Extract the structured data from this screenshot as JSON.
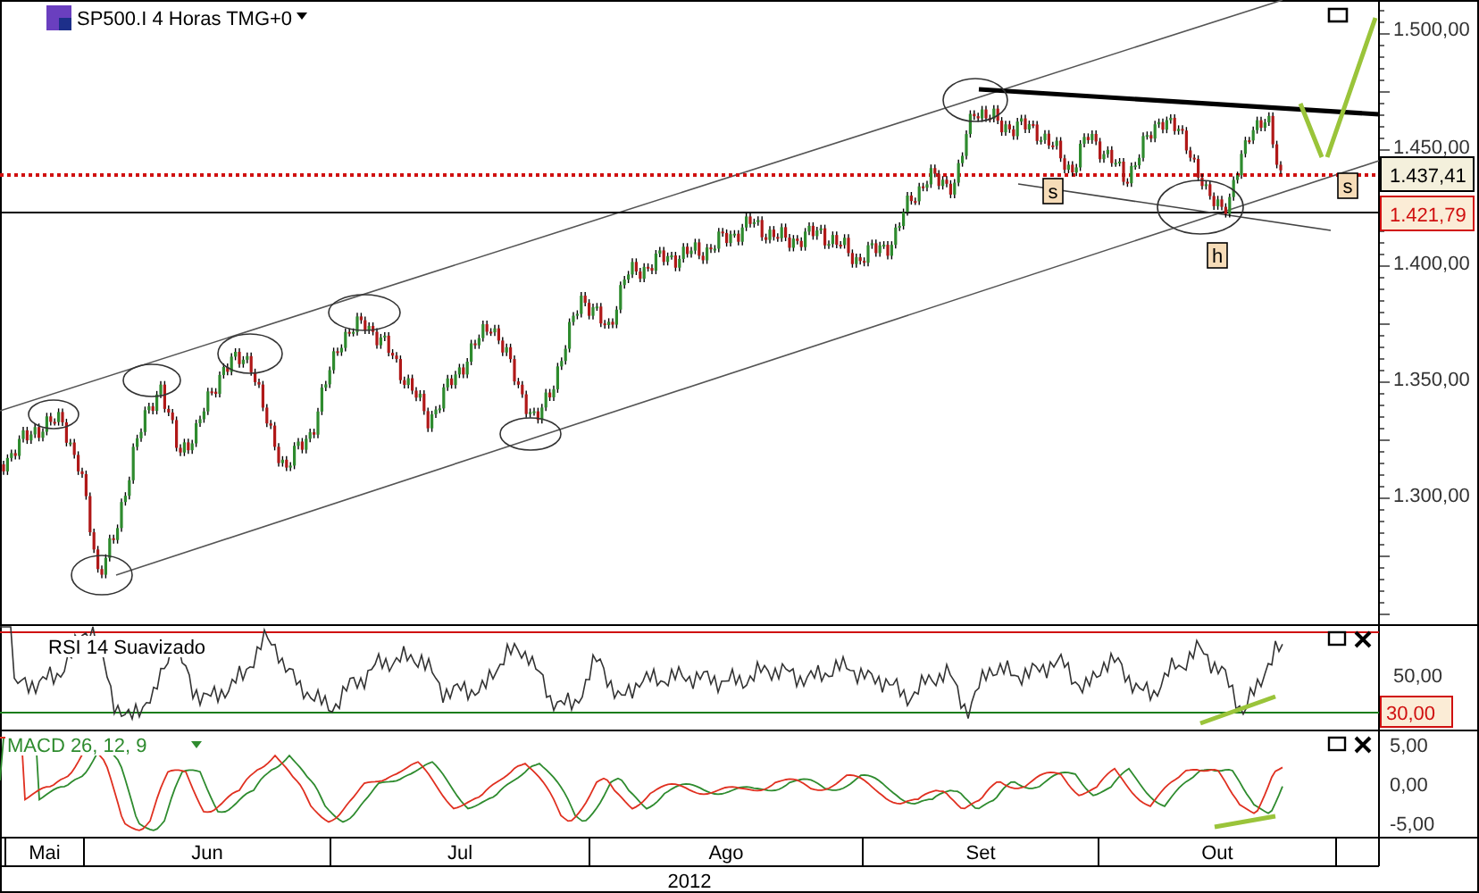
{
  "chart_title": "SP500.I 4 Horas TMG+0",
  "price_axis": {
    "labels": [
      "1.500,00",
      "1.450,00",
      "1.400,00",
      "1.350,00",
      "1.300,00"
    ]
  },
  "price_tags": [
    {
      "kind": "last",
      "text": "1.437,41"
    },
    {
      "kind": "level",
      "text": "1.421,79"
    }
  ],
  "annotations": [
    {
      "text": "s"
    },
    {
      "text": "s"
    },
    {
      "text": "h"
    }
  ],
  "rsi": {
    "title": "RSI 14 Suavizado",
    "labels": [
      "50,00"
    ],
    "tag": "30,00"
  },
  "macd": {
    "title": "MACD 26, 12, 9",
    "labels": [
      "5,00",
      "0,00",
      "-5,00"
    ]
  },
  "months": [
    "Mai",
    "Jun",
    "Jul",
    "Ago",
    "Set",
    "Out"
  ],
  "year": "2012"
}
